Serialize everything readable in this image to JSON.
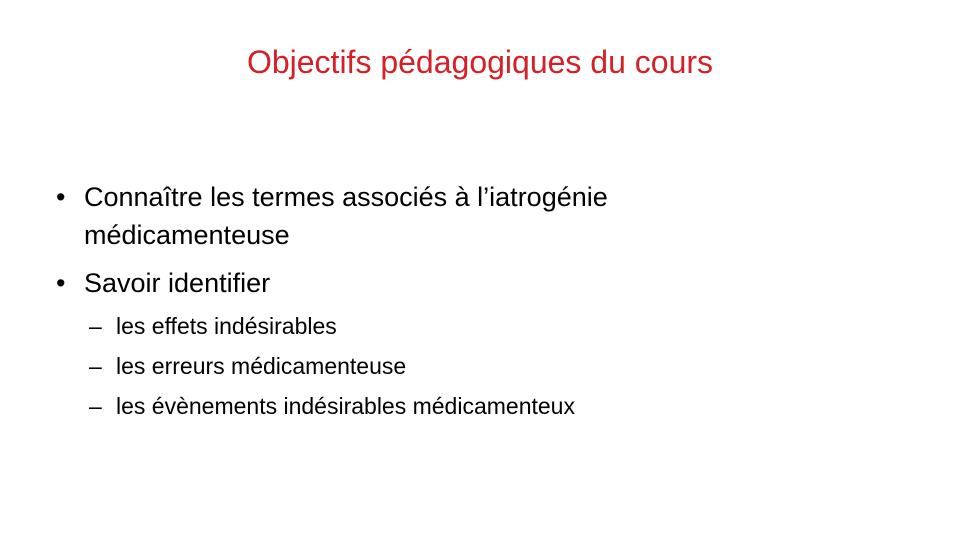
{
  "slide": {
    "title": "Objectifs pédagogiques du cours",
    "title_color": "#d62027",
    "bullet_glyph": "•",
    "sub_glyph": "–",
    "bullets": [
      {
        "line1": "Connaître les termes associés à l’iatrogénie",
        "line2": "médicamenteuse"
      },
      {
        "text": "Savoir identifier",
        "subitems": [
          "les effets indésirables",
          "les erreurs médicamenteuse",
          "les évènements indésirables médicamenteux"
        ]
      }
    ]
  }
}
